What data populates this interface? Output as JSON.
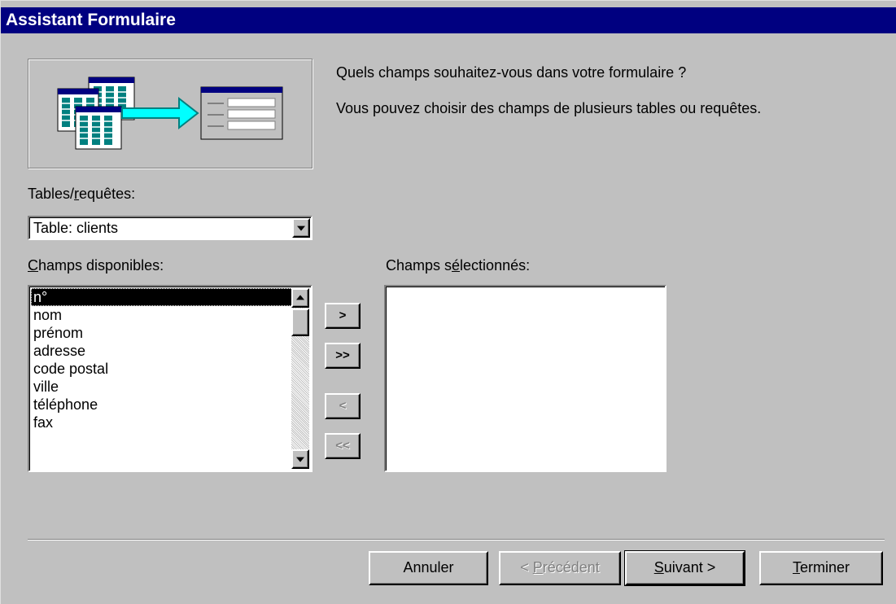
{
  "window": {
    "title": "Assistant Formulaire"
  },
  "prompt": {
    "question": "Quels champs souhaitez-vous dans votre formulaire ?",
    "explanation": "Vous pouvez choisir des champs de plusieurs tables ou requêtes."
  },
  "tables": {
    "label_prefix": "Tables/",
    "label_accel": "r",
    "label_suffix": "equêtes:",
    "selected": "Table: clients"
  },
  "available": {
    "label_accel": "C",
    "label_suffix": "hamps disponibles:",
    "items": [
      "n°",
      "nom",
      "prénom",
      "adresse",
      "code postal",
      "ville",
      "téléphone",
      "fax"
    ],
    "selected_index": 0
  },
  "selected_fields": {
    "label_prefix": "Champs s",
    "label_accel": "é",
    "label_suffix": "lectionnés:",
    "items": []
  },
  "move_buttons": {
    "add_one": ">",
    "add_all": ">>",
    "remove_one": "<",
    "remove_all": "<<"
  },
  "footer": {
    "cancel": "Annuler",
    "prev_prefix": "< ",
    "prev_accel": "P",
    "prev_suffix": "récédent",
    "next_accel": "S",
    "next_suffix": "uivant >",
    "finish_accel": "T",
    "finish_suffix": "erminer"
  }
}
